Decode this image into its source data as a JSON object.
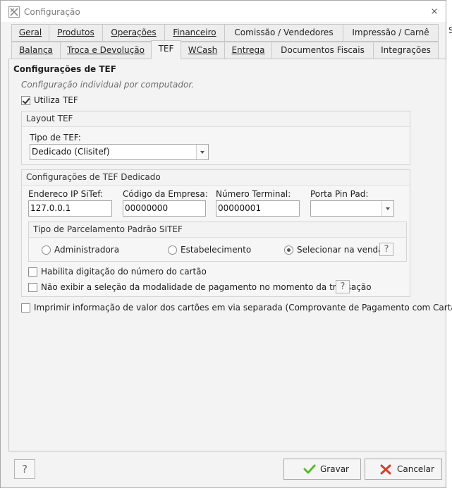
{
  "window": {
    "title": "Configuração",
    "close_glyph": "⨯",
    "edge_glyph": "S"
  },
  "tabs_row1": [
    {
      "label": "Geral"
    },
    {
      "label": "Produtos"
    },
    {
      "label": "Operações"
    },
    {
      "label": "Financeiro"
    },
    {
      "label": "Comissão / Vendedores"
    },
    {
      "label": "Impressão / Carnê"
    }
  ],
  "tabs_row2": [
    {
      "label": "Balança"
    },
    {
      "label": "Troca e Devolução"
    },
    {
      "label": "TEF",
      "active": true
    },
    {
      "label": "WCash"
    },
    {
      "label": "Entrega"
    },
    {
      "label": "Documentos Fiscais"
    },
    {
      "label": "Integrações"
    }
  ],
  "tef": {
    "heading": "Configurações de TEF",
    "hint": "Configuração individual por computador.",
    "utiliza_tef": {
      "label": "Utiliza TEF",
      "checked": true
    },
    "layout_group": {
      "title": "Layout TEF",
      "tipo_label": "Tipo de TEF:",
      "tipo_value": "Dedicado (Clisitef)"
    },
    "dedicado_group": {
      "title": "Configurações de TEF Dedicado",
      "ip_label": "Endereco IP SiTef:",
      "ip_value": "127.0.0.1",
      "empresa_label": "Código da Empresa:",
      "empresa_value": "00000000",
      "terminal_label": "Número Terminal:",
      "terminal_value": "00000001",
      "pinpad_label": "Porta Pin Pad:",
      "pinpad_value": "",
      "parcelamento": {
        "title": "Tipo de Parcelamento Padrão SITEF",
        "options": [
          "Administradora",
          "Estabelecimento",
          "Selecionar na venda"
        ],
        "selected": "Selecionar na venda",
        "help_glyph": "?"
      },
      "digitacao": {
        "label": "Habilita digitação do número do cartão",
        "checked": false
      },
      "nao_exibir": {
        "label": "Não exibir a seleção da modalidade de pagamento no momento da transação",
        "checked": false
      },
      "help_glyph": "?"
    },
    "imprimir": {
      "label": "Imprimir informação de valor dos cartões em via separada (Comprovante de Pagamento com Cartão)",
      "checked": false
    }
  },
  "footer": {
    "help_glyph": "?",
    "save_label": "Gravar",
    "cancel_label": "Cancelar"
  },
  "icons": {
    "app": "app-logo-icon",
    "close": "close-icon",
    "save": "checkmark-icon",
    "cancel": "x-icon",
    "help": "help-icon"
  },
  "colors": {
    "save_check": "#5cb82f",
    "cancel_x": "#d6402a"
  }
}
